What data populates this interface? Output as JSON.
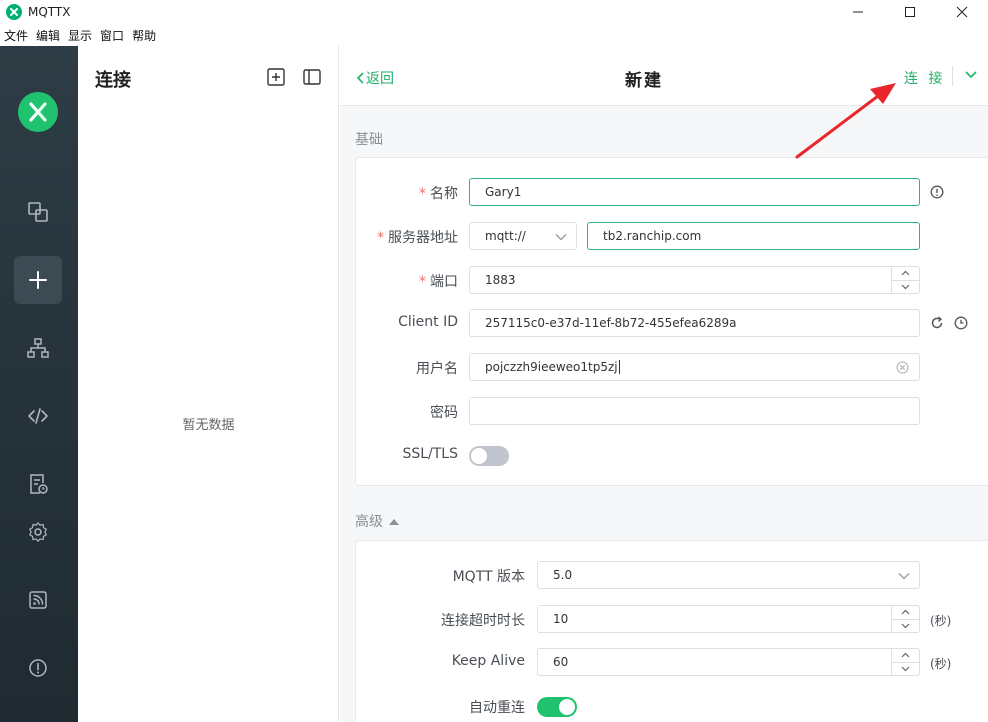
{
  "window": {
    "title": "MQTTX",
    "brand_color": "#20c26f"
  },
  "menu": [
    "文件",
    "编辑",
    "显示",
    "窗口",
    "帮助"
  ],
  "connections": {
    "title": "连接",
    "empty": "暂无数据"
  },
  "topbar": {
    "back": "返回",
    "title": "新建",
    "connect": "连 接"
  },
  "basic": {
    "section": "基础",
    "name_label": "名称",
    "name_value": "Gary1",
    "host_label": "服务器地址",
    "protocol": "mqtt://",
    "host_value": "tb2.ranchip.com",
    "port_label": "端口",
    "port_value": "1883",
    "clientid_label": "Client ID",
    "clientid_value": "257115c0-e37d-11ef-8b72-455efea6289a",
    "username_label": "用户名",
    "username_value": "pojczzh9ieeweo1tp5zj",
    "password_label": "密码",
    "password_value": "",
    "ssl_label": "SSL/TLS",
    "ssl_on": false
  },
  "advanced": {
    "section": "高级",
    "mqtt_version_label": "MQTT 版本",
    "mqtt_version_value": "5.0",
    "timeout_label": "连接超时时长",
    "timeout_value": "10",
    "timeout_unit": "(秒)",
    "keepalive_label": "Keep Alive",
    "keepalive_value": "60",
    "keepalive_unit": "(秒)",
    "reconnect_label": "自动重连",
    "reconnect_on": true
  }
}
